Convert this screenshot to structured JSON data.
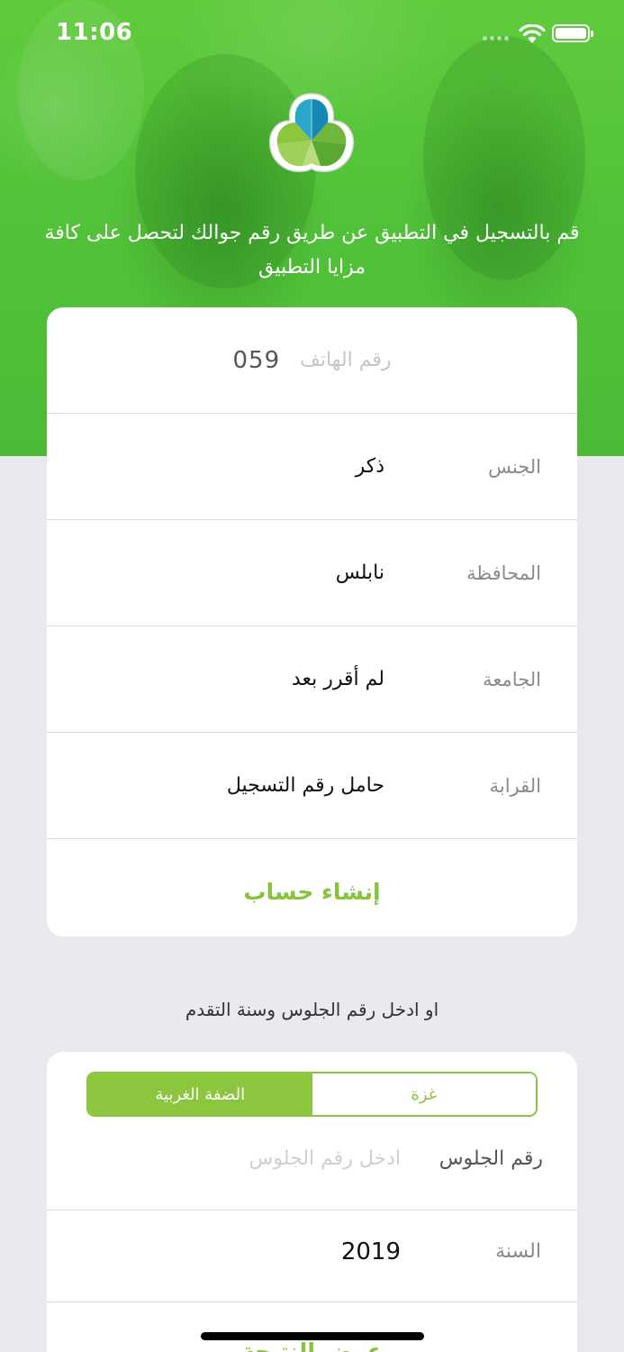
{
  "status_bar": {
    "time": "11:06",
    "icons": [
      "signal-dots-icon",
      "wifi-icon",
      "battery-icon"
    ]
  },
  "hero": {
    "logo_icon": "app-logo-icon",
    "description": "قم بالتسجيل في التطبيق عن طريق رقم جوالك لتحصل على كافة مزايا التطبيق"
  },
  "register_form": {
    "phone": {
      "prefix": "059",
      "placeholder": "رقم الهاتف"
    },
    "gender": {
      "label": "الجنس",
      "value": "ذكر"
    },
    "governorate": {
      "label": "المحافظة",
      "value": "نابلس"
    },
    "university": {
      "label": "الجامعة",
      "value": "لم أقرر بعد"
    },
    "relation": {
      "label": "القرابة",
      "value": "حامل رقم التسجيل"
    },
    "create_button": "إنشاء حساب"
  },
  "alternative_text": "او ادخل رقم الجلوس وسنة التقدم",
  "seat_form": {
    "segments": {
      "west_bank": "الضفة الغربية",
      "gaza": "غزة",
      "selected": "الضفة الغربية"
    },
    "seat_number": {
      "label": "رقم الجلوس",
      "placeholder": "ادخل رقم الجلوس"
    },
    "year": {
      "label": "السنة",
      "value": "2019"
    },
    "submit_button": "عرض النتيجة"
  },
  "colors": {
    "hero_green": "#53c23a",
    "accent_green": "#8cc63f",
    "background": "#e9e9ee"
  }
}
